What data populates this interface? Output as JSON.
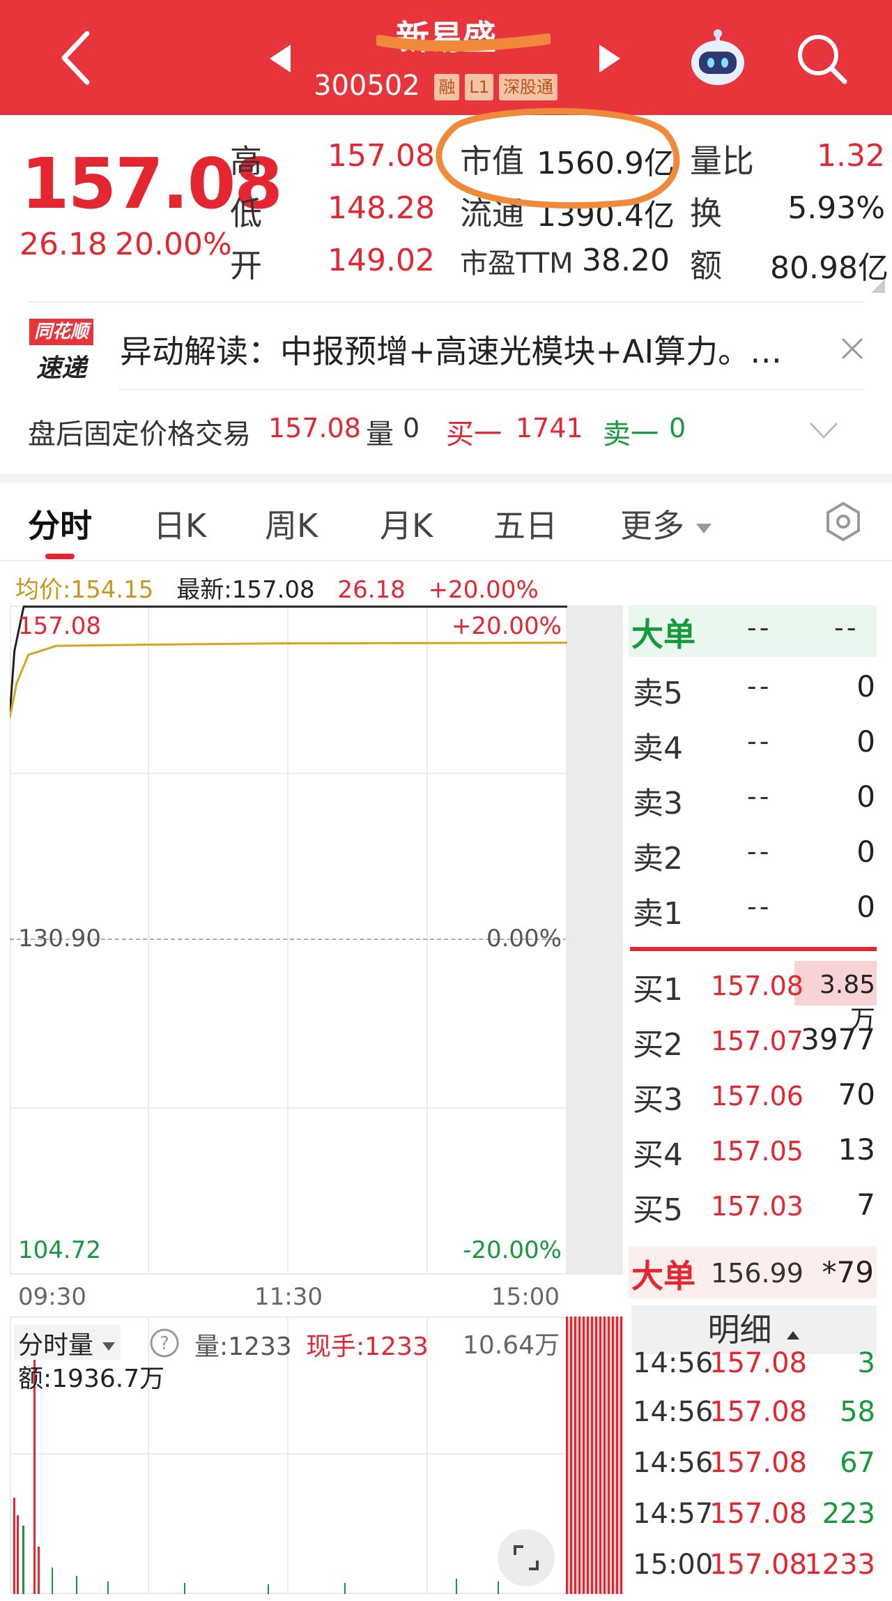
{
  "header": {
    "stock_name": "新易盛",
    "stock_code": "300502",
    "flags": [
      "融",
      "L1",
      "深股通"
    ]
  },
  "quote": {
    "price": "157.08",
    "change": "26.18",
    "change_pct": "20.00%",
    "high_label": "高",
    "high": "157.08",
    "low_label": "低",
    "low": "148.28",
    "open_label": "开",
    "open": "149.02",
    "mktcap_label": "市值",
    "mktcap": "1560.9亿",
    "float_label": "流通",
    "float": "1390.4亿",
    "pe_label": "市盈TTM",
    "pe": "38.20",
    "volratio_label": "量比",
    "volratio": "1.32",
    "turnover_label": "换",
    "turnover": "5.93%",
    "amount_label": "额",
    "amount": "80.98亿"
  },
  "news": {
    "brand_top": "同花顺",
    "brand_bottom": "速递",
    "text": "异动解读：中报预增+高速光模块+AI算力。…"
  },
  "afterhours": {
    "title": "盘后固定价格交易",
    "price": "157.08",
    "vol_label": "量",
    "vol": "0",
    "buy_label": "买一",
    "buy": "1741",
    "sell_label": "卖一",
    "sell": "0"
  },
  "tabs": [
    "分时",
    "日K",
    "周K",
    "月K",
    "五日",
    "更多"
  ],
  "chart_info": {
    "avg_label": "均价:154.15",
    "latest_label": "最新:157.08",
    "change": "26.18",
    "change_pct": "+20.00%"
  },
  "chart_data": {
    "type": "line",
    "title": "",
    "xlabel": "",
    "ylabel": "",
    "x_ticks": [
      "09:30",
      "11:30",
      "15:00"
    ],
    "ylim": [
      104.72,
      157.08
    ],
    "y_labels_left": [
      "157.08",
      "130.90",
      "104.72"
    ],
    "y_labels_right": [
      "+20.00%",
      "0.00%",
      "-20.00%"
    ],
    "series": [
      {
        "name": "最新",
        "color": "#222222",
        "x": [
          0,
          2,
          6,
          12,
          20,
          240
        ],
        "y": [
          148.5,
          153.5,
          157.08,
          157.08,
          157.08,
          157.08
        ]
      },
      {
        "name": "均价",
        "color": "#d4a51f",
        "x": [
          0,
          3,
          8,
          20,
          60,
          120,
          180,
          240
        ],
        "y": [
          148.3,
          151.0,
          153.2,
          153.9,
          154.0,
          154.1,
          154.12,
          154.15
        ]
      }
    ]
  },
  "volume": {
    "label": "分时量",
    "vol": "量:1233",
    "hand": "现手:1233",
    "max": "10.64万",
    "amount": "额:1936.7万"
  },
  "orderbook": {
    "big_label": "大单",
    "big_a": "--",
    "big_b": "--",
    "sells": [
      {
        "label": "卖5",
        "price": "--",
        "qty": "0"
      },
      {
        "label": "卖4",
        "price": "--",
        "qty": "0"
      },
      {
        "label": "卖3",
        "price": "--",
        "qty": "0"
      },
      {
        "label": "卖2",
        "price": "--",
        "qty": "0"
      },
      {
        "label": "卖1",
        "price": "--",
        "qty": "0"
      }
    ],
    "buys": [
      {
        "label": "买1",
        "price": "157.08",
        "qty": "3.85万"
      },
      {
        "label": "买2",
        "price": "157.07",
        "qty": "3977"
      },
      {
        "label": "买3",
        "price": "157.06",
        "qty": "70"
      },
      {
        "label": "买4",
        "price": "157.05",
        "qty": "13"
      },
      {
        "label": "买5",
        "price": "157.03",
        "qty": "7"
      }
    ],
    "big2_label": "大单",
    "big2_price": "156.99",
    "big2_qty": "*79",
    "detail_label": "明细"
  },
  "ticks": [
    {
      "time": "14:56",
      "price": "157.08",
      "qty": "3",
      "color": "green"
    },
    {
      "time": "14:56",
      "price": "157.08",
      "qty": "58",
      "color": "green"
    },
    {
      "time": "14:56",
      "price": "157.08",
      "qty": "67",
      "color": "green"
    },
    {
      "time": "14:57",
      "price": "157.08",
      "qty": "223",
      "color": "green"
    },
    {
      "time": "15:00",
      "price": "157.08",
      "qty": "1233",
      "color": "red"
    }
  ],
  "colors": {
    "red": "#e3262f",
    "green": "#15993b",
    "header": "#e8353b",
    "avg": "#d4a51f"
  }
}
